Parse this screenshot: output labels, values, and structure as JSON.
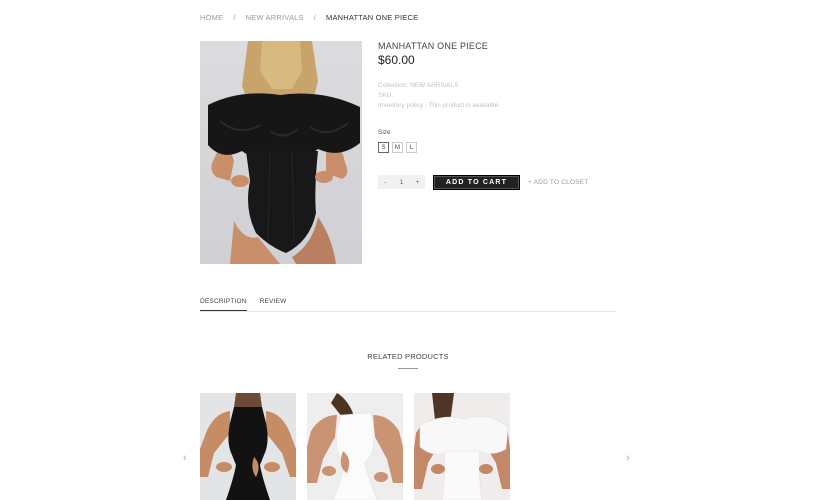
{
  "breadcrumb": {
    "home": "HOME",
    "separator": "/",
    "collection": "NEW ARRIVALS",
    "current": "MANHATTAN ONE PIECE"
  },
  "product": {
    "title": "MANHATTAN ONE PIECE",
    "price": "$60.00",
    "collection": "Collection: NEW ARRIVALS",
    "sku": "SKU:",
    "inventory": "Inventory policy : This product is available",
    "size_label": "Size",
    "sizes": [
      "S",
      "M",
      "L"
    ],
    "selected_size": "S",
    "quantity": {
      "minus": "-",
      "value": "1",
      "plus": "+"
    },
    "add_to_cart": "ADD TO CART",
    "add_to_closet": "+ ADD TO CLOSET"
  },
  "tabs": [
    "DESCRIPTION",
    "REVIEW"
  ],
  "related": {
    "title": "RELATED PRODUCTS",
    "prev_arrow": "‹",
    "next_arrow": "›"
  },
  "colors": {
    "button_bg": "#222222",
    "swimsuit_black": "#151515",
    "swimsuit_white": "#fafafa"
  }
}
